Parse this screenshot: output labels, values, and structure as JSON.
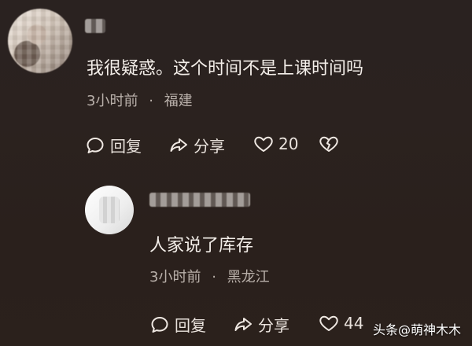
{
  "comment_main": {
    "text": "我很疑惑。这个时间不是上课时间吗",
    "meta_time": "3小时前",
    "meta_sep": "·",
    "meta_location": "福建",
    "actions": {
      "reply_label": "回复",
      "share_label": "分享",
      "like_count": "20"
    }
  },
  "comment_reply": {
    "text": "人家说了库存",
    "meta_time": "3小时前",
    "meta_sep": "·",
    "meta_location": "黑龙江",
    "actions": {
      "reply_label": "回复",
      "share_label": "分享",
      "like_count": "44"
    }
  },
  "watermark": {
    "text": "头条@萌神木木"
  }
}
